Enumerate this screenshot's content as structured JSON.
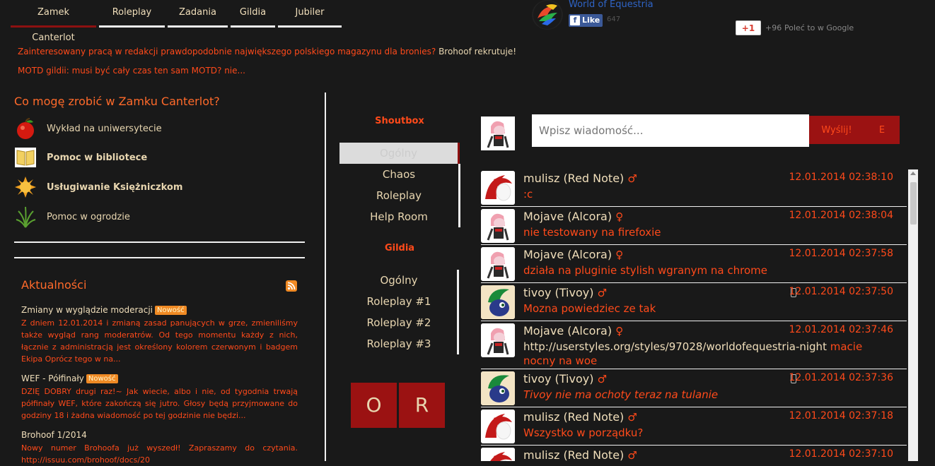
{
  "tabs": [
    {
      "label": "Zamek Canterlot",
      "active": true
    },
    {
      "label": "Roleplay"
    },
    {
      "label": "Zadania"
    },
    {
      "label": "Gildia"
    },
    {
      "label": "Jubiler"
    }
  ],
  "announcements": {
    "line1": "Zainteresowany pracą w redakcji prawdopodobnie największego polskiego magazynu dla bronies?",
    "line1_tail": "Brohoof rekrutuje!",
    "line2": "MOTD gildii: musi być cały czas ten sam MOTD? nie..."
  },
  "social": {
    "page_name": "World of Equestria",
    "fb_like": "Like",
    "fb_count": "647",
    "gplus": "+1",
    "gplus_count": "+96",
    "gplus_text": "Poleć to w Google"
  },
  "activities": {
    "title": "Co mogę zrobić w Zamku Canterlot?",
    "items": [
      {
        "label": "Wykład na uniwersytecie",
        "icon": "apple-icon"
      },
      {
        "label": "Pomoc w bibliotece",
        "icon": "book-icon"
      },
      {
        "label": "Usługiwanie Księżniczkom",
        "icon": "sun-icon"
      },
      {
        "label": "Pomoc w ogrodzie",
        "icon": "grass-icon"
      }
    ]
  },
  "news": {
    "title": "Aktualności",
    "badge": "Nowość",
    "items": [
      {
        "title": "Zmiany w wyglądzie moderacji",
        "new": true,
        "body": "Z dniem 12.01.2014 i zmianą zasad panujących w grze, zmieniliśmy także wygląd rang moderatrów. Od tego momentu każdy z nich, łącznie z administracją jest określony kolorem czerwonym i badgem Ekipa Oprócz tego w na..."
      },
      {
        "title": "WEF - Półfinały",
        "new": true,
        "body": "DZIĘ DOBRY drugi raz!~ Jak wiecie, albo i nie, od tygodnia trwają półfinały WEF, które zakończą się jutro. Głosy będą przyjmowane do godziny 18 i żadna wiadomość po tej godzinie nie będzi..."
      },
      {
        "title": "Brohoof 1/2014",
        "new": false,
        "body": "Nowy numer Brohoofa już wyszedł! Zapraszamy do czytania. http://issuu.com/brohoof/docs/20"
      }
    ]
  },
  "nav": {
    "shoutbox_title": "Shoutbox",
    "shoutbox_items": [
      "Ogólny",
      "Chaos",
      "Roleplay",
      "Help Room"
    ],
    "guild_title": "Gildia",
    "guild_items": [
      "Ogólny",
      "Roleplay #1",
      "Roleplay #2",
      "Roleplay #3"
    ],
    "btn_o": "O",
    "btn_r": "R"
  },
  "composer": {
    "placeholder": "Wpisz wiadomość...",
    "send": "Wyślij!",
    "extra": "E"
  },
  "messages": [
    {
      "name": "mulisz (Red Note)",
      "gender": "♂",
      "time": "12.01.2014 02:38:10",
      "text": ":c",
      "avatar": "red-note"
    },
    {
      "name": "Mojave (Alcora)",
      "gender": "♀",
      "time": "12.01.2014 02:38:04",
      "text": "nie testowany na firefoxie",
      "avatar": "alcora"
    },
    {
      "name": "Mojave (Alcora)",
      "gender": "♀",
      "time": "12.01.2014 02:37:58",
      "text": "działa na pluginie stylish wgranym na chrome",
      "avatar": "alcora"
    },
    {
      "name": "tivoy (Tivoy)",
      "gender": "♂",
      "time": "12.01.2014 02:37:50",
      "text": "Mozna powiedziec ze tak",
      "avatar": "tivoy",
      "mobile": true
    },
    {
      "name": "Mojave (Alcora)",
      "gender": "♀",
      "time": "12.01.2014 02:37:46",
      "url": "http://userstyles.org/styles/97028/worldofequestria-night",
      "text": " macie nocny na woe",
      "avatar": "alcora"
    },
    {
      "name": "tivoy (Tivoy)",
      "gender": "♂",
      "time": "12.01.2014 02:37:36",
      "text": "Tivoy nie ma ochoty teraz na tulanie",
      "italic": true,
      "avatar": "tivoy",
      "mobile": true
    },
    {
      "name": "mulisz (Red Note)",
      "gender": "♂",
      "time": "12.01.2014 02:37:18",
      "text": "Wszystko w porządku?",
      "avatar": "red-note"
    },
    {
      "name": "mulisz (Red Note)",
      "gender": "♂",
      "time": "12.01.2014 02:37:10",
      "text": "",
      "avatar": "red-note"
    }
  ]
}
